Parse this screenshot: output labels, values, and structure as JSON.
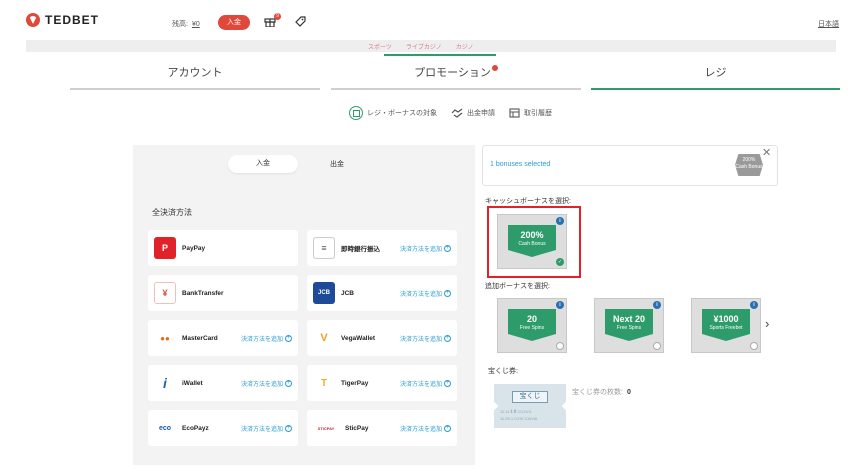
{
  "header": {
    "logo_text": "TEDBET",
    "balance_label": "残高:",
    "balance_value": "¥0",
    "deposit_button": "入金",
    "gift_badge": "9",
    "language": "日本語"
  },
  "subnav": {
    "links": [
      "スポーツ",
      "ライブカジノ",
      "カジノ"
    ]
  },
  "tabs": [
    {
      "label": "アカウント"
    },
    {
      "label": "プロモーション"
    },
    {
      "label": "レジ"
    }
  ],
  "subtabs": [
    {
      "label": "レジ・ボーナスの対象"
    },
    {
      "label": "出金申請"
    },
    {
      "label": "取引履歴"
    }
  ],
  "payment": {
    "deposit_tab": "入金",
    "withdraw_tab": "出金",
    "section_title": "全決済方法",
    "add_method_label": "決済方法を追加",
    "methods": [
      {
        "name": "PayPay",
        "icon": "P",
        "icon_color": "#e0232a"
      },
      {
        "name": "即時銀行振込",
        "icon": "≡",
        "icon_color": "#555555"
      },
      {
        "name": "BankTransfer",
        "icon": "¥",
        "icon_color": "#e0483a"
      },
      {
        "name": "JCB",
        "icon": "JCB",
        "icon_color": "#1d4b9a"
      },
      {
        "name": "MasterCard",
        "icon": "●●",
        "icon_color": "#eb6a1a"
      },
      {
        "name": "VegaWallet",
        "icon": "V",
        "icon_color": "#f0a020"
      },
      {
        "name": "iWallet",
        "icon": "i",
        "icon_color": "#2a5fb0"
      },
      {
        "name": "TigerPay",
        "icon": "T",
        "icon_color": "#f0b020"
      },
      {
        "name": "EcoPayz",
        "icon": "eco",
        "icon_color": "#1d5aa0"
      },
      {
        "name": "SticPay",
        "icon": "STICPAY",
        "icon_color": "#e0232a"
      }
    ]
  },
  "bonus": {
    "selected_text": "1 bonuses selected",
    "mini_bonus_top": "200%",
    "mini_bonus_bottom": "Cash Bonus",
    "cash_bonus_label": "キャッシュボーナスを選択:",
    "extra_bonus_label": "追加ボーナスを選択:",
    "cash_bonus": {
      "big": "200%",
      "small": "Cash Bonus"
    },
    "extra_bonuses": [
      {
        "big": "20",
        "small": "Free Spins"
      },
      {
        "big": "Next 20",
        "small": "Free Spins"
      },
      {
        "big": "¥1000",
        "small": "Sports Freebet"
      }
    ],
    "lottery_label": "宝くじ券:",
    "ticket_title": "宝くじ",
    "ticket_line_1": "11.11.Ⅱ.Ⅲ CCXVII",
    "ticket_line_2": "11.29.1 CXVI CXIVIII",
    "lottery_count_label": "宝くじ券の枚数:",
    "lottery_count": "0"
  },
  "colors": {
    "brand_red": "#e0483a",
    "accent_green": "#2e9c6a",
    "link_blue": "#2a9dd0"
  }
}
